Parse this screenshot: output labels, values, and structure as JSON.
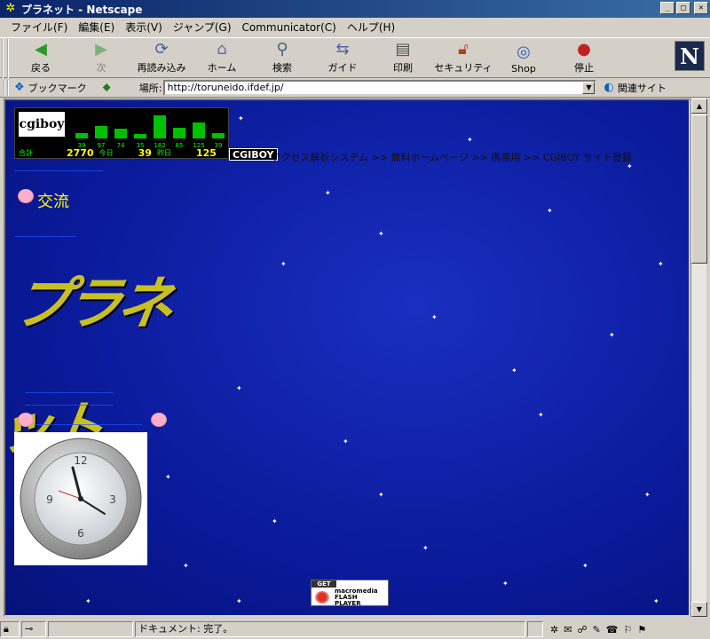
{
  "window": {
    "title": "プラネット - Netscape"
  },
  "menu": [
    "ファイル(F)",
    "編集(E)",
    "表示(V)",
    "ジャンプ(G)",
    "Communicator(C)",
    "ヘルプ(H)"
  ],
  "toolbar": [
    {
      "label": "戻る",
      "icon": "back-arrow-icon",
      "enabled": true
    },
    {
      "label": "次",
      "icon": "forward-arrow-icon",
      "enabled": false
    },
    {
      "label": "再読み込み",
      "icon": "reload-icon",
      "enabled": true
    },
    {
      "label": "ホーム",
      "icon": "home-icon",
      "enabled": true
    },
    {
      "label": "検索",
      "icon": "search-icon",
      "enabled": true
    },
    {
      "label": "ガイド",
      "icon": "guide-icon",
      "enabled": true
    },
    {
      "label": "印刷",
      "icon": "print-icon",
      "enabled": true
    },
    {
      "label": "セキュリティ",
      "icon": "lock-icon",
      "enabled": true
    },
    {
      "label": "Shop",
      "icon": "shop-icon",
      "enabled": true
    },
    {
      "label": "停止",
      "icon": "stop-icon",
      "enabled": true
    }
  ],
  "location": {
    "bookmark_label": "ブックマーク",
    "location_label": "場所:",
    "url": "http://toruneido.ifdef.jp/",
    "related_label": "関連サイト"
  },
  "page": {
    "counter": {
      "logo": "cgiboy",
      "bars": [
        39,
        97,
        74,
        35,
        182,
        85,
        125,
        39
      ],
      "total_label": "合計",
      "total": "2770",
      "today_label": "今日",
      "today": "39",
      "yesterday_label": "昨日",
      "yesterday": "125"
    },
    "cgiboy_badge": "CGIBOY",
    "cgiboy_text": "アクセス解析システム >> 無料ホームページ >> 携帯用 >> CGIBOY サイト登録",
    "section_title": "交流"
  },
  "status": {
    "text": "ドキュメント: 完了。"
  },
  "colors": {
    "bg_blue": "#0a1a9a",
    "title_yellow": "#ffff00",
    "link_blue": "#2050ff",
    "counter_green": "#00c000"
  }
}
